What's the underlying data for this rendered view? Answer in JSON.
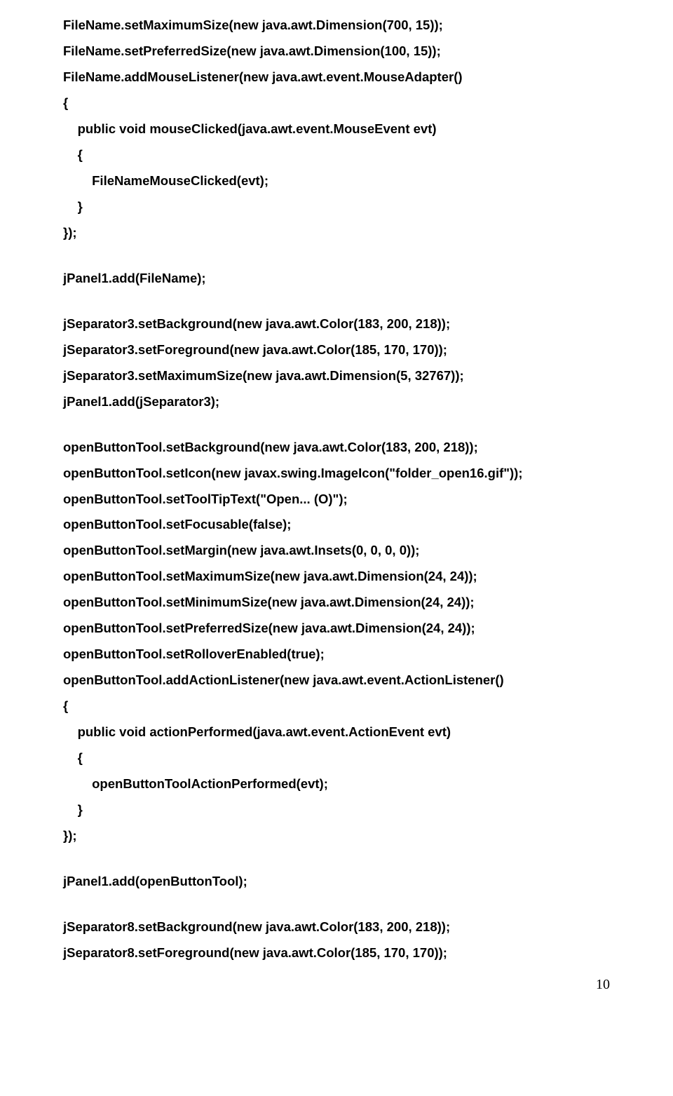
{
  "lines": [
    "FileName.setMaximumSize(new java.awt.Dimension(700, 15));",
    "FileName.setPreferredSize(new java.awt.Dimension(100, 15));",
    "FileName.addMouseListener(new java.awt.event.MouseAdapter()",
    "{",
    "    public void mouseClicked(java.awt.event.MouseEvent evt)",
    "    {",
    "        FileNameMouseClicked(evt);",
    "    }",
    "});",
    "",
    "jPanel1.add(FileName);",
    "",
    "jSeparator3.setBackground(new java.awt.Color(183, 200, 218));",
    "jSeparator3.setForeground(new java.awt.Color(185, 170, 170));",
    "jSeparator3.setMaximumSize(new java.awt.Dimension(5, 32767));",
    "jPanel1.add(jSeparator3);",
    "",
    "openButtonTool.setBackground(new java.awt.Color(183, 200, 218));",
    "openButtonTool.setIcon(new javax.swing.ImageIcon(\"folder_open16.gif\"));",
    "openButtonTool.setToolTipText(\"Open... (O)\");",
    "openButtonTool.setFocusable(false);",
    "openButtonTool.setMargin(new java.awt.Insets(0, 0, 0, 0));",
    "openButtonTool.setMaximumSize(new java.awt.Dimension(24, 24));",
    "openButtonTool.setMinimumSize(new java.awt.Dimension(24, 24));",
    "openButtonTool.setPreferredSize(new java.awt.Dimension(24, 24));",
    "openButtonTool.setRolloverEnabled(true);",
    "openButtonTool.addActionListener(new java.awt.event.ActionListener()",
    "{",
    "    public void actionPerformed(java.awt.event.ActionEvent evt)",
    "    {",
    "        openButtonToolActionPerformed(evt);",
    "    }",
    "});",
    "",
    "jPanel1.add(openButtonTool);",
    "",
    "jSeparator8.setBackground(new java.awt.Color(183, 200, 218));",
    "jSeparator8.setForeground(new java.awt.Color(185, 170, 170));"
  ],
  "page_number": "10"
}
